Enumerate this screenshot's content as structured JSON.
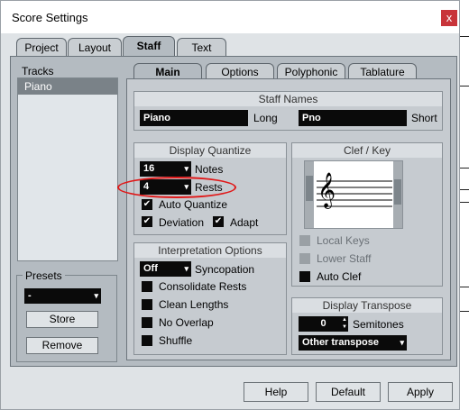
{
  "window": {
    "title": "Score Settings",
    "close_glyph": "x"
  },
  "top_tabs": [
    {
      "label": "Project"
    },
    {
      "label": "Layout"
    },
    {
      "label": "Staff"
    },
    {
      "label": "Text"
    }
  ],
  "tracks": {
    "label": "Tracks",
    "items": [
      "Piano"
    ]
  },
  "presets": {
    "label": "Presets",
    "selected": "-",
    "store_label": "Store",
    "remove_label": "Remove"
  },
  "sub_tabs": [
    {
      "label": "Main"
    },
    {
      "label": "Options"
    },
    {
      "label": "Polyphonic"
    },
    {
      "label": "Tablature"
    }
  ],
  "staff_names": {
    "header": "Staff Names",
    "long_value": "Piano",
    "long_label": "Long",
    "short_value": "Pno",
    "short_label": "Short"
  },
  "display_quantize": {
    "header": "Display Quantize",
    "notes_value": "16",
    "notes_label": "Notes",
    "rests_value": "4",
    "rests_label": "Rests",
    "auto_quantize_label": "Auto Quantize",
    "deviation_label": "Deviation",
    "adapt_label": "Adapt",
    "check_glyph": "✔"
  },
  "interpretation": {
    "header": "Interpretation Options",
    "syncopation_value": "Off",
    "syncopation_label": "Syncopation",
    "consolidate_label": "Consolidate Rests",
    "clean_lengths_label": "Clean Lengths",
    "no_overlap_label": "No Overlap",
    "shuffle_label": "Shuffle"
  },
  "clef_key": {
    "header": "Clef / Key",
    "clef_glyph": "𝄞",
    "local_keys_label": "Local Keys",
    "lower_staff_label": "Lower Staff",
    "auto_clef_label": "Auto Clef"
  },
  "display_transpose": {
    "header": "Display Transpose",
    "semitones_value": "0",
    "semitones_label": "Semitones",
    "transpose_value": "Other transpose"
  },
  "footer": {
    "help_label": "Help",
    "default_label": "Default",
    "apply_label": "Apply"
  },
  "glyphs": {
    "dropdown_arrow": "▾",
    "spin_up": "▲",
    "spin_down": "▼"
  },
  "colors": {
    "selection": "#7a8288",
    "annotation": "#e01818",
    "close": "#c8343a"
  }
}
